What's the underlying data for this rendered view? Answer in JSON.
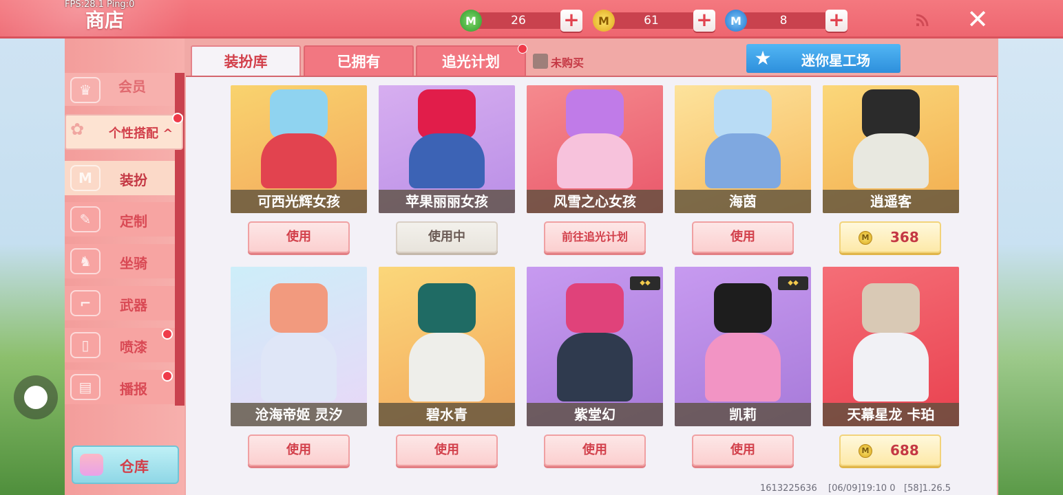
{
  "debug": {
    "fps_text": "FPS:28.1 Ping:0"
  },
  "header": {
    "title": "商店",
    "currencies": [
      {
        "icon": "green-m-coin-icon",
        "value": "26",
        "color": "#3fae3c"
      },
      {
        "icon": "gold-m-coin-icon",
        "value": "61",
        "color": "#f2c21b"
      },
      {
        "icon": "blue-m-coin-icon",
        "value": "8",
        "color": "#2f8de0"
      }
    ]
  },
  "sidebar": {
    "member": "会员",
    "personal": "个性搭配",
    "items": [
      {
        "label": "装扮",
        "icon": "shirt-icon"
      },
      {
        "label": "定制",
        "icon": "brush-icon"
      },
      {
        "label": "坐骑",
        "icon": "mount-icon"
      },
      {
        "label": "武器",
        "icon": "gun-icon"
      },
      {
        "label": "喷漆",
        "icon": "spray-can-icon"
      },
      {
        "label": "播报",
        "icon": "broadcast-icon"
      }
    ],
    "warehouse": "仓库"
  },
  "tabs": [
    {
      "label": "装扮库"
    },
    {
      "label": "已拥有"
    },
    {
      "label": "追光计划"
    }
  ],
  "filter": {
    "unbought_label": "未购买"
  },
  "studio_button": "迷你星工场",
  "cards": [
    {
      "name": "可西光辉女孩",
      "action": "使用",
      "bg": [
        "#f9d36e",
        "#f3a85c"
      ],
      "hair": "#8fd3f0",
      "body": "#e2434f"
    },
    {
      "name": "苹果丽丽女孩",
      "action": "使用中",
      "bg": [
        "#d7aef0",
        "#b98ee6"
      ],
      "hair": "#e11d4a",
      "body": "#3c63b5"
    },
    {
      "name": "风雪之心女孩",
      "action": "前往追光计划",
      "bg": [
        "#f58a8e",
        "#e9576a"
      ],
      "hair": "#c07be8",
      "body": "#f7c2dc"
    },
    {
      "name": "海茵",
      "action": "使用",
      "bg": [
        "#fde39c",
        "#f6b95d"
      ],
      "hair": "#b9dcf5",
      "body": "#7fa8e0"
    },
    {
      "name": "逍遥客",
      "action": "368",
      "bg": [
        "#fbd77a",
        "#f2ad4f"
      ],
      "hair": "#2b2b2b",
      "body": "#e8e8e0"
    },
    {
      "name": "沧海帝姬 灵汐",
      "action": "使用",
      "bg": [
        "#cdeef9",
        "#e9d7f7"
      ],
      "hair": "#f29a7e",
      "body": "#dfe6f7"
    },
    {
      "name": "碧水青",
      "action": "使用",
      "bg": [
        "#fbd77a",
        "#f3a85c"
      ],
      "hair": "#1f6b64",
      "body": "#eeeeea"
    },
    {
      "name": "紫堂幻",
      "action": "使用",
      "bg": [
        "#c79af0",
        "#a77ad9"
      ],
      "hair": "#e0427a",
      "body": "#2f3a4e"
    },
    {
      "name": "凯莉",
      "action": "使用",
      "bg": [
        "#c79af0",
        "#a77ad9"
      ],
      "hair": "#1d1d1d",
      "body": "#f294c4"
    },
    {
      "name": "天幕星龙 卡珀",
      "action": "688",
      "bg": [
        "#f56e77",
        "#e9414f"
      ],
      "hair": "#d9c9b5",
      "body": "#f1f1f5"
    }
  ],
  "footer": {
    "id": "1613225636",
    "date": "[06/09]19:10 0",
    "version": "[58]1.26.5"
  }
}
